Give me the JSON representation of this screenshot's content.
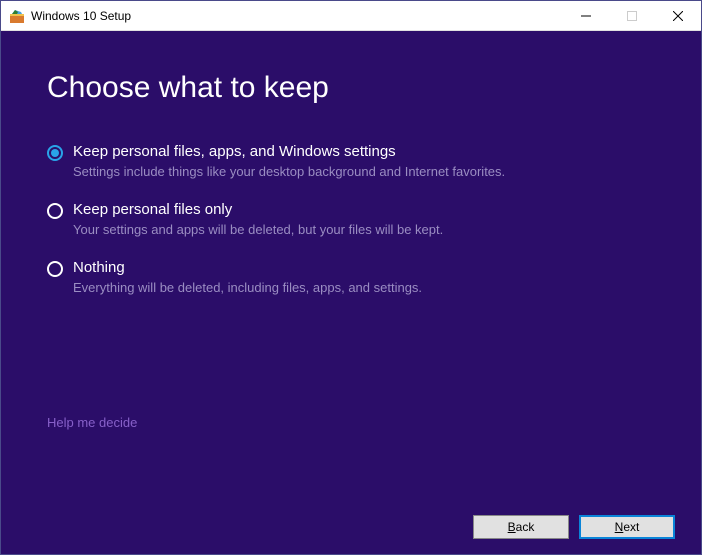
{
  "titlebar": {
    "title": "Windows 10 Setup"
  },
  "heading": "Choose what to keep",
  "options": [
    {
      "label": "Keep personal files, apps, and Windows settings",
      "desc": "Settings include things like your desktop background and Internet favorites.",
      "selected": true
    },
    {
      "label": "Keep personal files only",
      "desc": "Your settings and apps will be deleted, but your files will be kept.",
      "selected": false
    },
    {
      "label": "Nothing",
      "desc": "Everything will be deleted, including files, apps, and settings.",
      "selected": false
    }
  ],
  "helpLink": "Help me decide",
  "buttons": {
    "back_prefix": "B",
    "back_rest": "ack",
    "next_prefix": "N",
    "next_rest": "ext"
  }
}
